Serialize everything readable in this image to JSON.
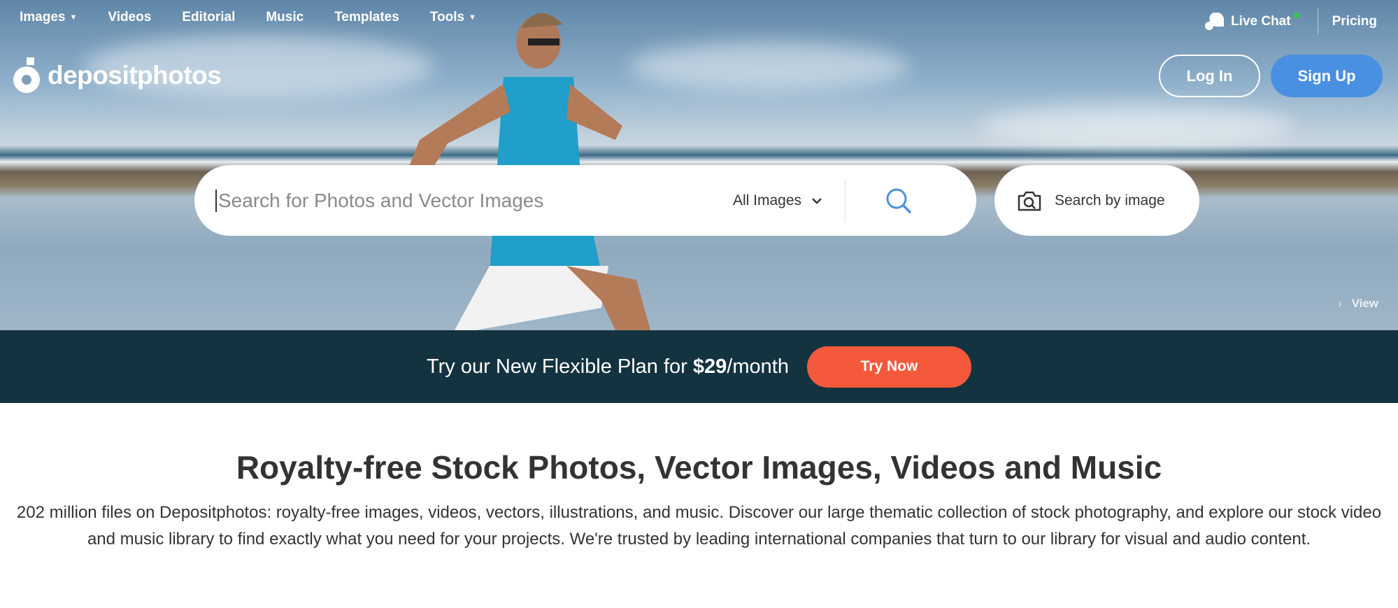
{
  "nav": {
    "items": [
      {
        "label": "Images",
        "dropdown": true
      },
      {
        "label": "Videos"
      },
      {
        "label": "Editorial"
      },
      {
        "label": "Music"
      },
      {
        "label": "Templates"
      },
      {
        "label": "Tools",
        "dropdown": true
      }
    ]
  },
  "logo": {
    "text": "depositphotos"
  },
  "topright": {
    "live_chat": "Live Chat",
    "pricing": "Pricing",
    "online_color": "#2ecc40"
  },
  "auth": {
    "login": "Log In",
    "signup": "Sign Up",
    "signup_color": "#4a90e2"
  },
  "search": {
    "placeholder": "Search for Photos and Vector Images",
    "value": "",
    "category": "All Images",
    "search_by_image": "Search by image"
  },
  "hero": {
    "view_link": "View"
  },
  "promo": {
    "text_before": "Try our New Flexible Plan for ",
    "price": "$29",
    "text_after": "/month",
    "cta": "Try Now",
    "bg_color": "#143340",
    "cta_color": "#f4593b"
  },
  "main": {
    "heading": "Royalty-free Stock Photos, Vector Images, Videos and Music",
    "description": "202 million files on Depositphotos: royalty-free images, videos, vectors, illustrations, and music. Discover our large thematic collection of stock photography, and explore our stock video and music library to find exactly what you need for your projects. We're trusted by leading international companies that turn to our library for visual and audio content."
  }
}
